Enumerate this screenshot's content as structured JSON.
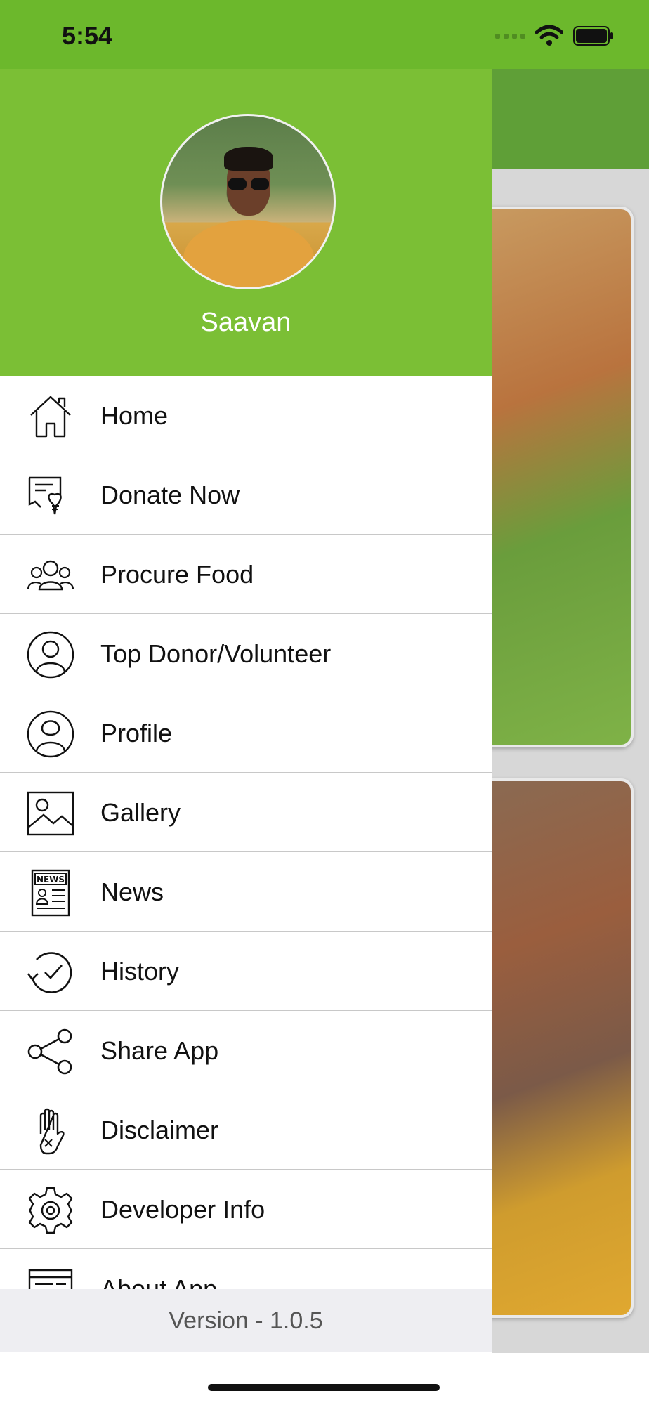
{
  "status_bar": {
    "time": "5:54",
    "icons": [
      "cellular-icon",
      "wifi-icon",
      "battery-icon"
    ],
    "color": "#6cb82c"
  },
  "drawer": {
    "header_color": "#7bbf35",
    "user_name": "Saavan",
    "items": [
      {
        "label": "Home",
        "icon": "home-icon"
      },
      {
        "label": "Donate Now",
        "icon": "donate-icon"
      },
      {
        "label": "Procure Food",
        "icon": "group-icon"
      },
      {
        "label": "Top Donor/Volunteer",
        "icon": "user-circle-icon"
      },
      {
        "label": "Profile",
        "icon": "profile-icon"
      },
      {
        "label": "Gallery",
        "icon": "image-icon"
      },
      {
        "label": "News",
        "icon": "news-icon"
      },
      {
        "label": "History",
        "icon": "history-icon"
      },
      {
        "label": "Share App",
        "icon": "share-icon"
      },
      {
        "label": "Disclaimer",
        "icon": "hand-icon"
      },
      {
        "label": "Developer Info",
        "icon": "gear-icon"
      },
      {
        "label": "About App",
        "icon": "browser-icon"
      }
    ],
    "version": "Version - 1.0.5"
  }
}
